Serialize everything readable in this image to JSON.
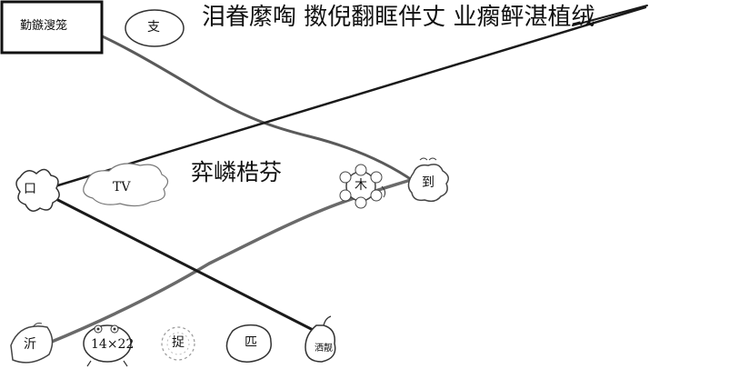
{
  "header": {
    "title": "泪眷縻啕 擞倪翻眶伴丈 业瘸鲆湛植绒"
  },
  "start_box": {
    "label": "勤鏃溲笼"
  },
  "mid_title": {
    "text": "弈嶙梏芬"
  },
  "nodes": {
    "top_bubble": "支",
    "left_flower": "口",
    "tv_cloud": "TV",
    "flower_mid": "木",
    "right_node": "到",
    "bottom_leaf": "沂",
    "bottom_creature": "14×22",
    "bottom_dashed_flower": "捉",
    "bottom_bubble": "匹",
    "bottom_pear": "洒靓"
  },
  "colors": {
    "dark_line": "#1a1a1a",
    "grey_line": "#5a5a5a",
    "outline": "#333333"
  }
}
